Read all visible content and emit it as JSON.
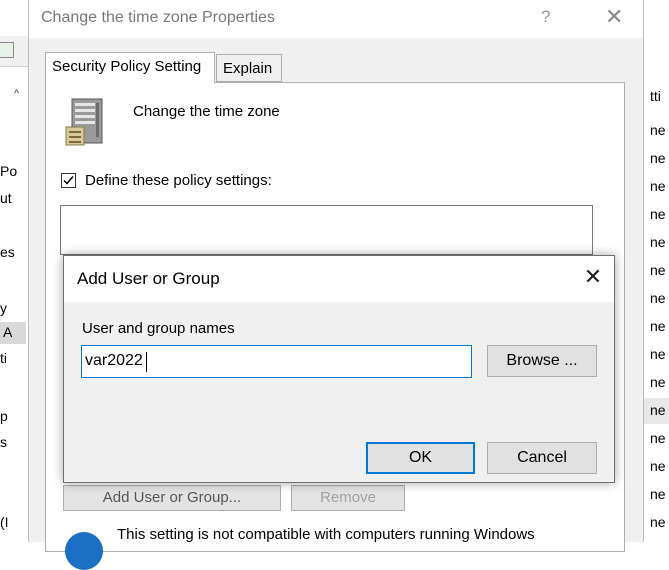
{
  "background": {
    "left_fragments": [
      "Po",
      "ut",
      "es",
      "y",
      "A",
      "ti",
      "p",
      "s",
      "(I"
    ],
    "right_fragments": [
      "tti",
      "ne",
      "ne",
      "ne",
      "ne",
      "ne",
      "ne",
      "ne",
      "ne",
      "ne",
      "ne",
      "ne",
      "ne",
      "ne",
      "ne",
      "ne",
      "ne",
      "ne"
    ]
  },
  "properties_dialog": {
    "title": "Change the time zone Properties",
    "help_label": "?",
    "close_label": "✕",
    "tabs": [
      {
        "label": "Security Policy Setting",
        "active": true
      },
      {
        "label": "Explain",
        "active": false
      }
    ],
    "policy_name": "Change the time zone",
    "define_checkbox": {
      "label": "Define these policy settings:",
      "checked": true
    },
    "add_button_label": "Add User or Group...",
    "remove_button_label": "Remove",
    "compat_text": "This setting is not compatible with computers running Windows",
    "info_icon_color": "#1c6fc4"
  },
  "add_user_dialog": {
    "title": "Add User or Group",
    "close_label": "✕",
    "field_label": "User and group names",
    "field_value": "var2022",
    "browse_label": "Browse ...",
    "ok_label": "OK",
    "cancel_label": "Cancel",
    "focus_color": "#0078d7"
  }
}
